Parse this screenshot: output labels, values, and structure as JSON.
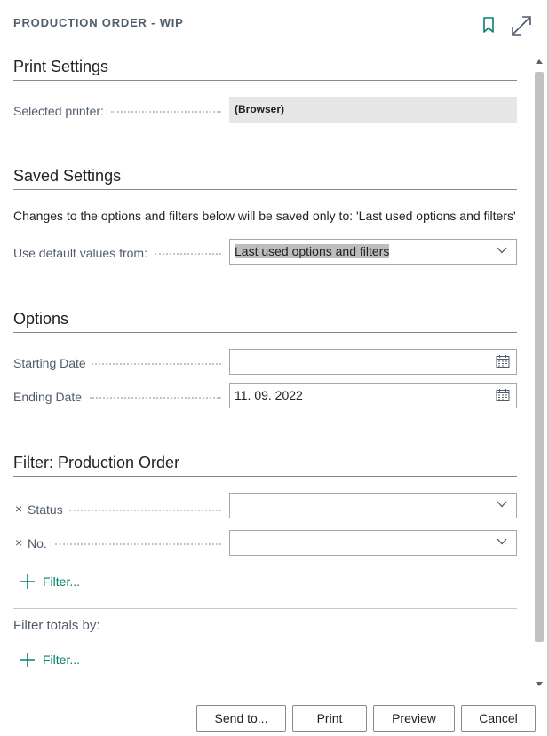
{
  "dialog": {
    "title": "PRODUCTION ORDER - WIP",
    "bookmark_icon": "bookmark-icon",
    "expand_icon": "expand-icon"
  },
  "print_settings": {
    "heading": "Print Settings",
    "printer_label": "Selected printer:",
    "printer_value": "(Browser)"
  },
  "saved_settings": {
    "heading": "Saved Settings",
    "note": "Changes to the options and filters below will be saved only to: 'Last used options and filters'",
    "default_label": "Use default values from:",
    "default_value": "Last used options and filters"
  },
  "options": {
    "heading": "Options",
    "starting_date_label": "Starting Date",
    "starting_date_value": "",
    "ending_date_label": "Ending Date",
    "ending_date_value": "11. 09. 2022"
  },
  "filter": {
    "heading": "Filter: Production Order",
    "remove_mark": "×",
    "status_label": "Status",
    "status_value": "",
    "no_label": "No.",
    "no_value": "",
    "add_filter_label": "Filter...",
    "totals_label": "Filter totals by:",
    "totals_add_filter_label": "Filter..."
  },
  "footer": {
    "send_to": "Send to...",
    "print": "Print",
    "preview": "Preview",
    "cancel": "Cancel"
  },
  "colors": {
    "accent": "#00806f",
    "label": "#505c6d",
    "readonly_bg": "#e6e6e6"
  }
}
